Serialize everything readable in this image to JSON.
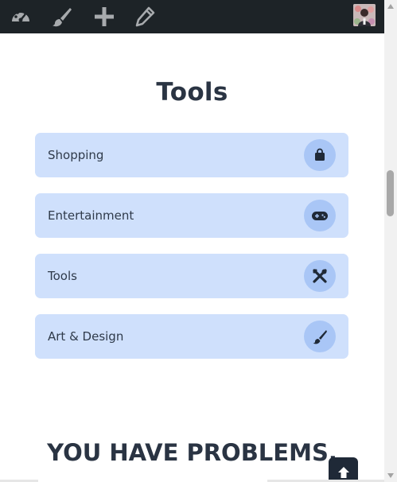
{
  "adminbar": {
    "icons": [
      "dashboard-icon",
      "customize-brush-icon",
      "add-new-icon",
      "edit-pencil-icon"
    ],
    "avatar": "user-avatar"
  },
  "section": {
    "title": "Tools"
  },
  "categories": [
    {
      "label": "Shopping",
      "icon": "shopping-bag-icon"
    },
    {
      "label": "Entertainment",
      "icon": "gamepad-icon"
    },
    {
      "label": "Tools",
      "icon": "tools-icon"
    },
    {
      "label": "Art & Design",
      "icon": "paint-brush-icon"
    }
  ],
  "bottom": {
    "heading": "YOU HAVE PROBLEMS,"
  },
  "colors": {
    "adminbar_bg": "#1d2327",
    "card_bg": "#cfe0fc",
    "icon_circle_bg": "#a9c6f6",
    "heading_text": "#2a3443",
    "back_to_top_bg": "#1f2937"
  }
}
